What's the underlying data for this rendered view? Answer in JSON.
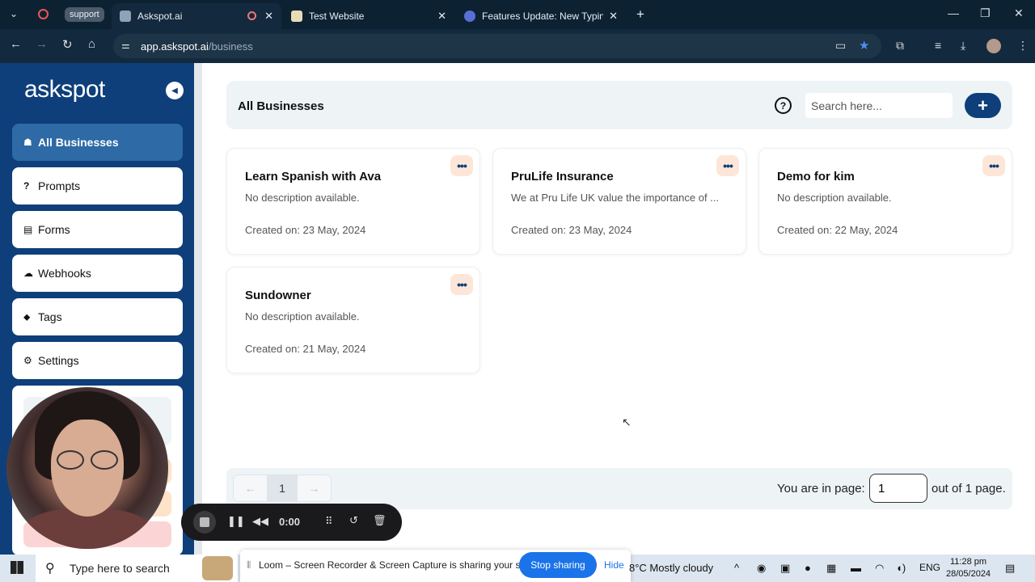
{
  "browser": {
    "tabs": [
      {
        "label": "support",
        "kind": "group-chip"
      },
      {
        "label": "Askspot.ai",
        "active": true
      },
      {
        "label": "Test Website"
      },
      {
        "label": "Features Update: New Typing A"
      }
    ],
    "url_domain": "app.askspot.ai",
    "url_path": "/business"
  },
  "app": {
    "logo": "askspot",
    "page_title": "All Businesses",
    "search_placeholder": "Search here...",
    "nav": [
      {
        "label": "All Businesses",
        "icon": "briefcase-icon",
        "active": true
      },
      {
        "label": "Prompts",
        "icon": "question-icon"
      },
      {
        "label": "Forms",
        "icon": "form-icon"
      },
      {
        "label": "Webhooks",
        "icon": "webhook-icon"
      },
      {
        "label": "Tags",
        "icon": "tags-icon"
      },
      {
        "label": "Settings",
        "icon": "gear-icon"
      }
    ],
    "businesses": [
      {
        "name": "Learn Spanish with Ava",
        "description": "No description available.",
        "created": "Created on: 23 May, 2024"
      },
      {
        "name": "PruLife Insurance",
        "description": "We at Pru Life UK value the importance of ...",
        "created": "Created on: 23 May, 2024"
      },
      {
        "name": "Demo for kim",
        "description": "No description available.",
        "created": "Created on: 22 May, 2024"
      },
      {
        "name": "Sundowner",
        "description": "No description available.",
        "created": "Created on: 21 May, 2024"
      }
    ],
    "pagination": {
      "current_page": "1",
      "info_prefix": "You are in page:",
      "info_suffix": "out of 1 page.",
      "input_value": "1"
    }
  },
  "recorder": {
    "timer": "0:00"
  },
  "taskbar": {
    "search_placeholder": "Type here to search",
    "share_message": "Loom – Screen Recorder & Screen Capture is sharing your screen.",
    "stop_label": "Stop sharing",
    "hide_label": "Hide",
    "weather": "8°C  Mostly cloudy",
    "language": "ENG",
    "time": "11:28 pm",
    "date": "28/05/2024"
  },
  "colors": {
    "sidebar": "#0e3f7a",
    "active_nav": "#2d6aa6",
    "accent": "#0e3f7a",
    "menu_chip": "#fde6d8"
  }
}
